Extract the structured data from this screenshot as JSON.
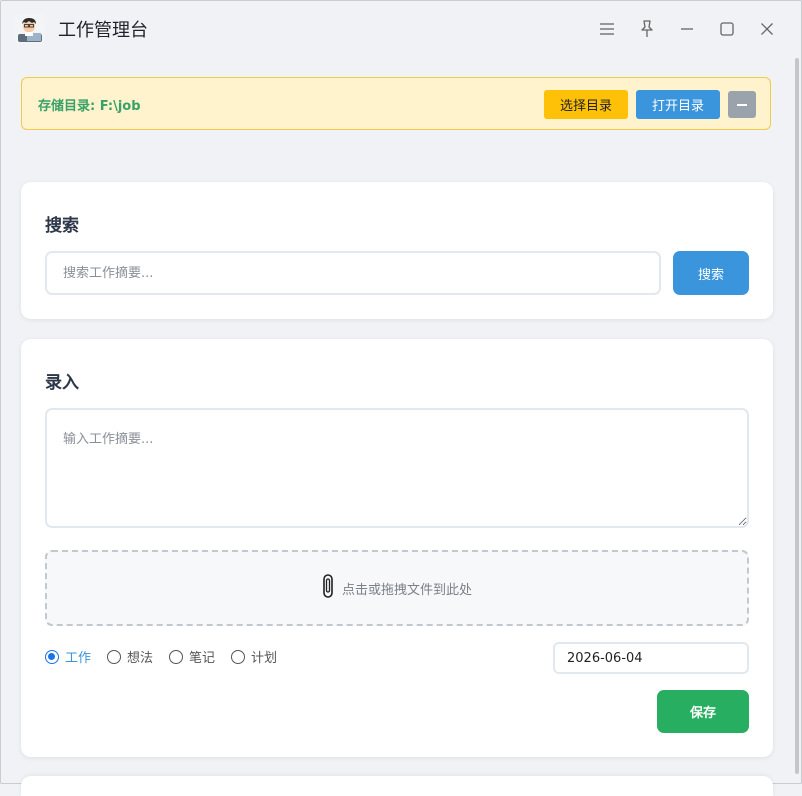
{
  "window": {
    "title": "工作管理台",
    "controls": [
      "menu-icon",
      "pin-icon",
      "minimize-icon",
      "maximize-icon",
      "close-icon"
    ]
  },
  "storage": {
    "label": "存储目录: F:\\job",
    "select_dir_label": "选择目录",
    "open_dir_label": "打开目录",
    "collapse_icon": "minus-icon",
    "colors": {
      "background": "#fff3cd",
      "border": "#f2c94c",
      "text": "#38a169",
      "select_button": "#ffc107",
      "open_button": "#3a95dd",
      "collapse_button": "#9aa3ab"
    }
  },
  "search": {
    "title": "搜索",
    "placeholder": "搜索工作摘要...",
    "value": "",
    "button_label": "搜索"
  },
  "entry": {
    "title": "录入",
    "placeholder": "输入工作摘要...",
    "value": "",
    "dropzone_icon": "paperclip-icon",
    "dropzone_text": "点击或拖拽文件到此处",
    "categories": [
      {
        "label": "工作",
        "checked": true
      },
      {
        "label": "想法",
        "checked": false
      },
      {
        "label": "笔记",
        "checked": false
      },
      {
        "label": "计划",
        "checked": false
      }
    ],
    "date": "2026-06-04",
    "save_label": "保存",
    "colors": {
      "primary": "#3a95dd",
      "save": "#27ae60"
    }
  }
}
